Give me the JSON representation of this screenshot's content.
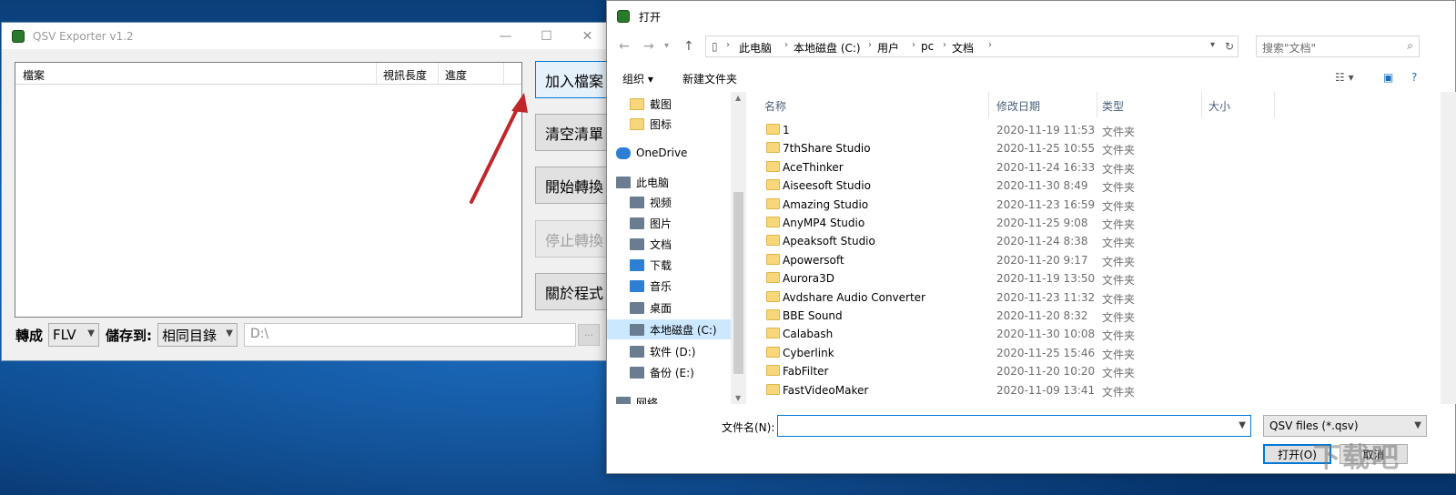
{
  "qsv": {
    "title": "QSV Exporter v1.2",
    "columns": [
      "檔案",
      "視訊長度",
      "進度"
    ],
    "buttons": {
      "add": "加入檔案",
      "clear": "清空清單",
      "start": "開始轉換",
      "stop": "停止轉換",
      "about": "關於程式"
    },
    "convert_label": "轉成",
    "format_value": "FLV",
    "save_label": "儲存到:",
    "save_mode": "相同目錄",
    "path_value": "D:\\",
    "browse": "..."
  },
  "dialog": {
    "title": "打开",
    "breadcrumb": [
      "此电脑",
      "本地磁盘 (C:)",
      "用户",
      "pc",
      "文档"
    ],
    "search_placeholder": "搜索\"文档\"",
    "toolbar": {
      "organize": "组织 ▾",
      "new_folder": "新建文件夹"
    },
    "nav_items": [
      {
        "label": "截图",
        "icon": "folder-icon"
      },
      {
        "label": "图标",
        "icon": "folder-icon"
      },
      {
        "label": "OneDrive",
        "icon": "cloud-icon"
      },
      {
        "label": "此电脑",
        "icon": "computer-icon"
      },
      {
        "label": "视频",
        "icon": "video-icon"
      },
      {
        "label": "图片",
        "icon": "picture-icon"
      },
      {
        "label": "文档",
        "icon": "document-icon"
      },
      {
        "label": "下载",
        "icon": "download-icon"
      },
      {
        "label": "音乐",
        "icon": "music-icon"
      },
      {
        "label": "桌面",
        "icon": "desktop-icon"
      },
      {
        "label": "本地磁盘 (C:)",
        "icon": "drive-icon"
      },
      {
        "label": "软件 (D:)",
        "icon": "drive-icon"
      },
      {
        "label": "备份 (E:)",
        "icon": "drive-icon"
      },
      {
        "label": "网络",
        "icon": "network-icon"
      }
    ],
    "columns": {
      "name": "名称",
      "date": "修改日期",
      "type": "类型",
      "size": "大小"
    },
    "files": [
      {
        "name": "1",
        "date": "2020-11-19 11:53",
        "type": "文件夹"
      },
      {
        "name": "7thShare Studio",
        "date": "2020-11-25 10:55",
        "type": "文件夹"
      },
      {
        "name": "AceThinker",
        "date": "2020-11-24 16:33",
        "type": "文件夹"
      },
      {
        "name": "Aiseesoft Studio",
        "date": "2020-11-30 8:49",
        "type": "文件夹"
      },
      {
        "name": "Amazing Studio",
        "date": "2020-11-23 16:59",
        "type": "文件夹"
      },
      {
        "name": "AnyMP4 Studio",
        "date": "2020-11-25 9:08",
        "type": "文件夹"
      },
      {
        "name": "Apeaksoft Studio",
        "date": "2020-11-24 8:38",
        "type": "文件夹"
      },
      {
        "name": "Apowersoft",
        "date": "2020-11-20 9:17",
        "type": "文件夹"
      },
      {
        "name": "Aurora3D",
        "date": "2020-11-19 13:50",
        "type": "文件夹"
      },
      {
        "name": "Avdshare Audio Converter",
        "date": "2020-11-23 11:32",
        "type": "文件夹"
      },
      {
        "name": "BBE Sound",
        "date": "2020-11-20 8:32",
        "type": "文件夹"
      },
      {
        "name": "Calabash",
        "date": "2020-11-30 10:08",
        "type": "文件夹"
      },
      {
        "name": "Cyberlink",
        "date": "2020-11-25 15:46",
        "type": "文件夹"
      },
      {
        "name": "FabFilter",
        "date": "2020-11-20 10:20",
        "type": "文件夹"
      },
      {
        "name": "FastVideoMaker",
        "date": "2020-11-09 13:41",
        "type": "文件夹"
      }
    ],
    "filename_label": "文件名(N):",
    "filename_value": "",
    "filter_value": "QSV files (*.qsv)",
    "open_label": "打开(O)",
    "cancel_label": "取消"
  },
  "watermark": "下载吧"
}
